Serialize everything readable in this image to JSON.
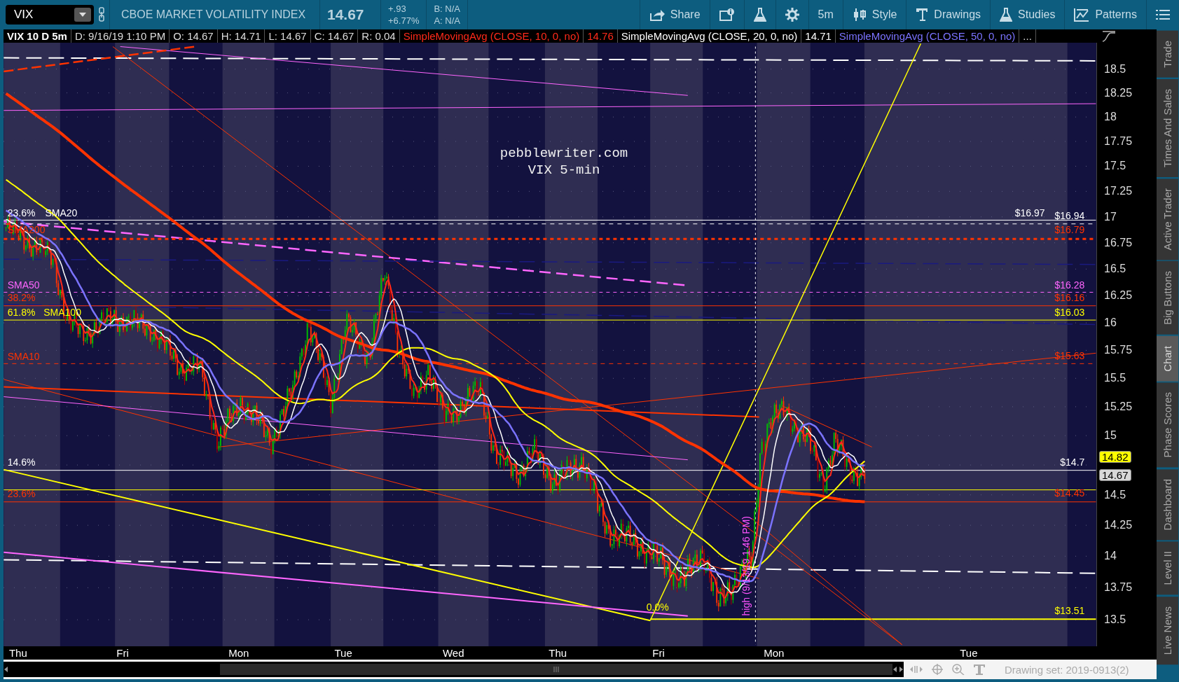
{
  "toolbar": {
    "symbol": "VIX",
    "description": "CBOE MARKET VOLATILITY INDEX",
    "last": "14.67",
    "change": "+.93",
    "change_pct": "+6.77%",
    "bid": "B: N/A",
    "ask": "A: N/A",
    "buttons": [
      {
        "kind": "share",
        "label": "Share"
      },
      {
        "kind": "info"
      },
      {
        "kind": "flask"
      },
      {
        "kind": "gear"
      },
      {
        "kind": "plain",
        "label": "5m"
      },
      {
        "kind": "style",
        "label": "Style"
      },
      {
        "kind": "drawings",
        "label": "Drawings"
      },
      {
        "kind": "studies",
        "label": "Studies"
      },
      {
        "kind": "patterns",
        "label": "Patterns"
      },
      {
        "kind": "menu"
      }
    ]
  },
  "info_bar": {
    "title": "VIX 10 D 5m",
    "fields": [
      "D: 9/16/19 1:10 PM",
      "O: 14.67",
      "H: 14.71",
      "L: 14.67",
      "C: 14.67",
      "R: 0.04"
    ],
    "studies": [
      {
        "name": "SimpleMovingAvg (CLOSE, 10, 0, no)",
        "value": "14.76",
        "color": "#ff2a1a"
      },
      {
        "name": "SimpleMovingAvg (CLOSE, 20, 0, no)",
        "value": "14.71",
        "color": "#ffffff"
      },
      {
        "name": "SimpleMovingAvg (CLOSE, 50, 0, no)",
        "color": "#7b73ff"
      }
    ],
    "more": "..."
  },
  "chart": {
    "annotation": [
      "pebblewriter.com",
      "VIX 5-min"
    ],
    "left_labels": [
      {
        "text": "23.6%",
        "color": "#ffffff"
      },
      {
        "text": "SMA20",
        "color": "#ffffff"
      },
      {
        "text": "SMA200",
        "color": "#ff3300"
      },
      {
        "text": "SMA50",
        "color": "#ff66ff"
      },
      {
        "text": "38.2%",
        "color": "#ff3300"
      },
      {
        "text": "61.8%",
        "color": "#ffff00"
      },
      {
        "text": "SMA100",
        "color": "#ffff00"
      },
      {
        "text": "SMA10",
        "color": "#ff3300"
      },
      {
        "text": "14.6%",
        "color": "#ffffff"
      },
      {
        "text": "23.6%",
        "color": "#ff3300"
      },
      {
        "text": "0.0%",
        "color": "#ffff00"
      }
    ],
    "right_labels": [
      {
        "text": "$16.97",
        "color": "#ffffff"
      },
      {
        "text": "$16.94",
        "color": "#ffffff"
      },
      {
        "text": "$16.79",
        "color": "#ff3300"
      },
      {
        "text": "$16.28",
        "color": "#ff66ff"
      },
      {
        "text": "$16.16",
        "color": "#ff3300"
      },
      {
        "text": "$16.03",
        "color": "#ffff00"
      },
      {
        "text": "$15.63",
        "color": "#ff3300"
      },
      {
        "text": "$14.7",
        "color": "#ffffff"
      },
      {
        "text": "$14.45",
        "color": "#ff3300"
      },
      {
        "text": "$13.51",
        "color": "#ffff00"
      }
    ],
    "vertical_label": "high (9/13/19 1:46 PM)",
    "price_axis_upper": [
      "18.5",
      "18.25",
      "18",
      "17.75",
      "17.5",
      "17.25",
      "17",
      "16.75",
      "16.5",
      "16.25",
      "16",
      "15.75",
      "15.5",
      "15.25",
      "15"
    ],
    "price_axis_lower": [
      "14.5",
      "14.25",
      "14",
      "13.75",
      "13.5"
    ],
    "price_badges": [
      {
        "text": "14.82",
        "color": "#ffff00"
      },
      {
        "text": "14.67",
        "color": "#d8d8d8"
      }
    ],
    "time_axis": [
      "Thu",
      "Fri",
      "Mon",
      "Tue",
      "Wed",
      "Thu",
      "Fri",
      "Mon",
      "Tue"
    ]
  },
  "bottom_bar": {
    "drawing_set": "Drawing set: 2019-0913(2)"
  },
  "sidebar": {
    "tabs": [
      {
        "label": "Trade",
        "selected": false
      },
      {
        "label": "Times And Sales",
        "selected": false
      },
      {
        "label": "Active Trader",
        "selected": false
      },
      {
        "label": "Big Buttons",
        "selected": false
      },
      {
        "label": "Chart",
        "selected": true
      },
      {
        "label": "Phase Scores",
        "selected": false
      },
      {
        "label": "Dashboard",
        "selected": false
      },
      {
        "label": "Level II",
        "selected": false
      },
      {
        "label": "Live News",
        "selected": false
      }
    ]
  }
}
